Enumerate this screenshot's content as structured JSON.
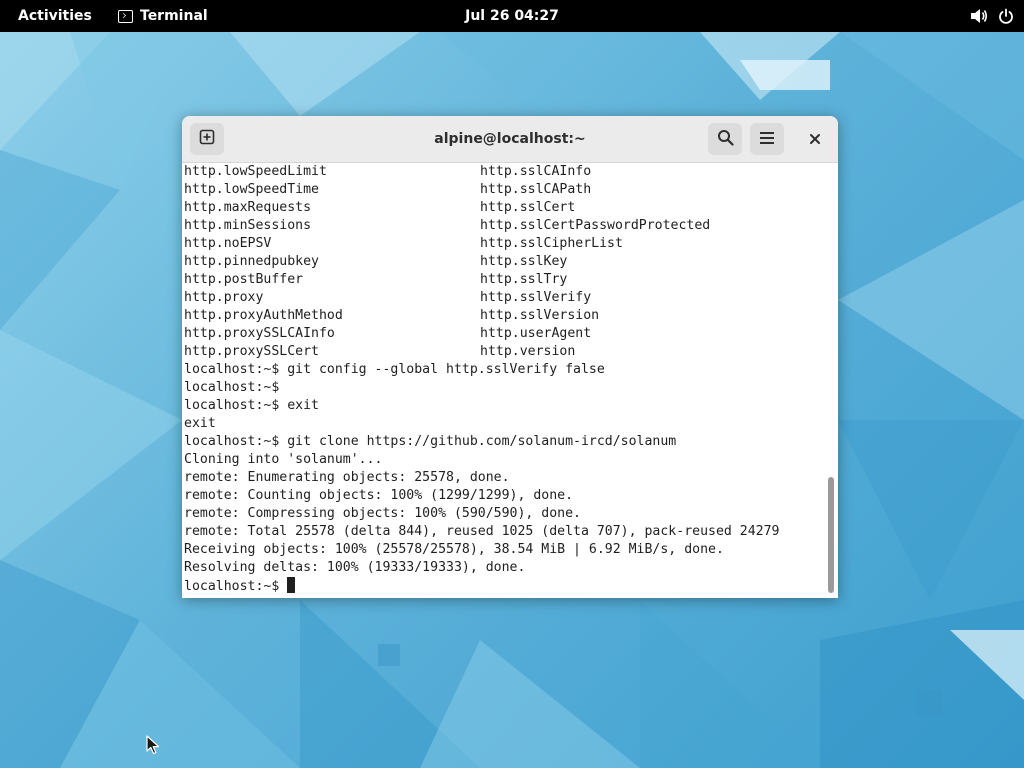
{
  "topbar": {
    "activities_label": "Activities",
    "app_label": "Terminal",
    "app_icon": "terminal-icon",
    "clock": "Jul 26  04:27",
    "status_icons": [
      "volume-icon",
      "power-icon"
    ]
  },
  "window": {
    "title": "alpine@localhost:~",
    "buttons": [
      "new-tab-icon",
      "search-icon",
      "menu-icon",
      "close-icon"
    ]
  },
  "terminal": {
    "columns": [
      [
        "http.lowSpeedLimit",
        "http.sslCAInfo"
      ],
      [
        "http.lowSpeedTime",
        "http.sslCAPath"
      ],
      [
        "http.maxRequests",
        "http.sslCert"
      ],
      [
        "http.minSessions",
        "http.sslCertPasswordProtected"
      ],
      [
        "http.noEPSV",
        "http.sslCipherList"
      ],
      [
        "http.pinnedpubkey",
        "http.sslKey"
      ],
      [
        "http.postBuffer",
        "http.sslTry"
      ],
      [
        "http.proxy",
        "http.sslVerify"
      ],
      [
        "http.proxyAuthMethod",
        "http.sslVersion"
      ],
      [
        "http.proxySSLCAInfo",
        "http.userAgent"
      ],
      [
        "http.proxySSLCert",
        "http.version"
      ]
    ],
    "lines": [
      "localhost:~$ git config --global http.sslVerify false",
      "localhost:~$",
      "localhost:~$ exit",
      "exit",
      "localhost:~$ git clone https://github.com/solanum-ircd/solanum",
      "Cloning into 'solanum'...",
      "remote: Enumerating objects: 25578, done.",
      "remote: Counting objects: 100% (1299/1299), done.",
      "remote: Compressing objects: 100% (590/590), done.",
      "remote: Total 25578 (delta 844), reused 1025 (delta 707), pack-reused 24279",
      "Receiving objects: 100% (25578/25578), 38.54 MiB | 6.92 MiB/s, done.",
      "Resolving deltas: 100% (19333/19333), done."
    ],
    "prompt": "localhost:~$ "
  },
  "colors": {
    "topbar_bg": "#000000",
    "headerbar_bg": "#ebebeb",
    "terminal_bg": "#ffffff",
    "terminal_fg": "#1f1f1f",
    "wallpaper_accent": "#5fb3da"
  }
}
